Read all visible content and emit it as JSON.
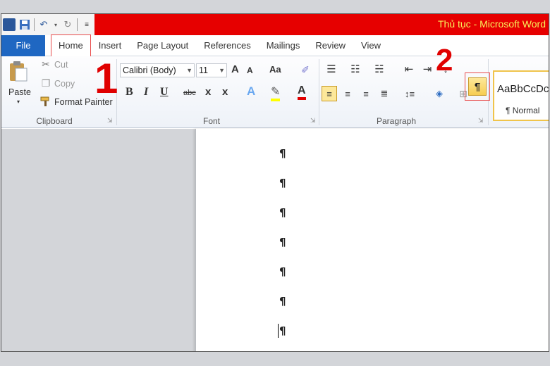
{
  "window": {
    "title": "Thủ tục - Microsoft Word"
  },
  "quick_access": {
    "icons": [
      "word-logo-icon",
      "save-icon",
      "undo-icon",
      "redo-icon",
      "customize-icon"
    ]
  },
  "tabs": [
    "File",
    "Home",
    "Insert",
    "Page Layout",
    "References",
    "Mailings",
    "Review",
    "View"
  ],
  "clipboard": {
    "group_label": "Clipboard",
    "paste": "Paste",
    "cut": "Cut",
    "copy": "Copy",
    "format_painter": "Format Painter"
  },
  "font": {
    "group_label": "Font",
    "font_name": "Calibri (Body)",
    "font_size": "11",
    "grow": "A",
    "shrink": "A",
    "change_case": "Aa",
    "bold": "B",
    "italic": "I",
    "underline": "U",
    "strikethrough": "abc",
    "subscript": "x",
    "superscript": "x",
    "text_effects": "A",
    "highlight": "✎",
    "font_color": "A"
  },
  "paragraph": {
    "group_label": "Paragraph",
    "show_hide_mark": "¶"
  },
  "styles": {
    "sample": "AaBbCcDc",
    "name": "¶ Normal"
  },
  "annotations": {
    "step1": "1",
    "step2": "2"
  },
  "document": {
    "marks": [
      "¶",
      "¶",
      "¶",
      "¶",
      "¶",
      "¶",
      "¶"
    ]
  },
  "colors": {
    "title_bar": "#e60000",
    "file_tab": "#1f67c2",
    "highlight_box": "#e84c4c",
    "annotation": "#e00000"
  }
}
